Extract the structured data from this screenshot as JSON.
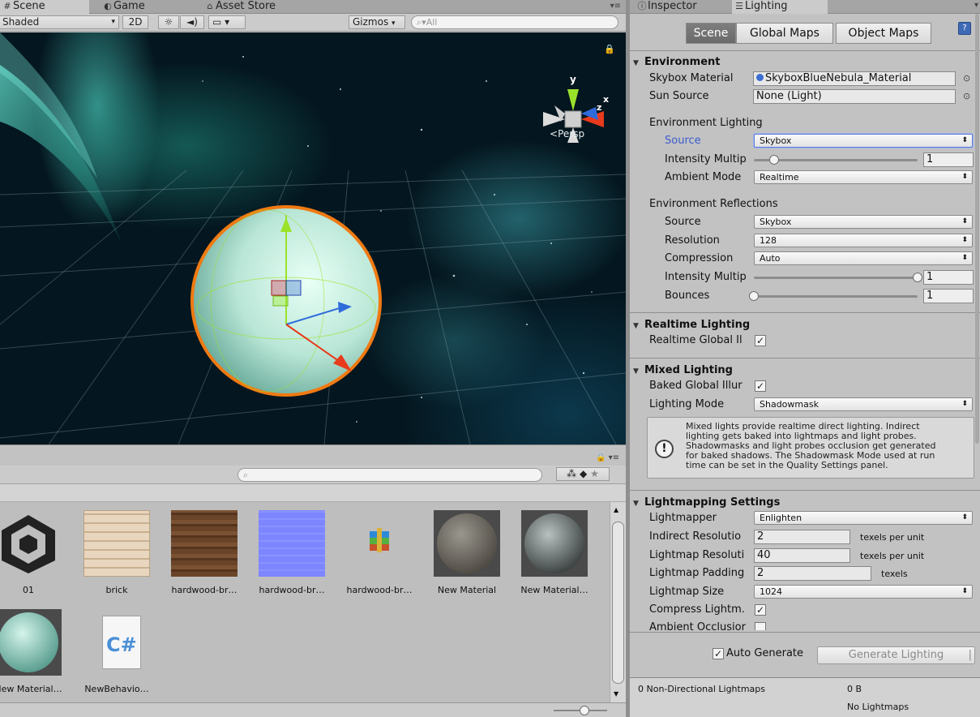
{
  "scene_tabs": {
    "scene": "Scene",
    "game": "Game",
    "asset_store": "Asset Store"
  },
  "scene_toolbar": {
    "draw_mode": "Shaded",
    "mode_2d": "2D",
    "gizmos": "Gizmos",
    "search_placeholder": "All"
  },
  "scene_view": {
    "gizmo_axes": {
      "y": "y",
      "x": "x",
      "z": "z"
    },
    "projection": "Persp"
  },
  "project": {
    "assets": [
      {
        "label": "01",
        "kind": "unity-logo"
      },
      {
        "label": "brick",
        "kind": "brick-texture"
      },
      {
        "label": "hardwood-br…",
        "kind": "wood-texture"
      },
      {
        "label": "hardwood-br…",
        "kind": "normal-map"
      },
      {
        "label": "hardwood-br…",
        "kind": "archive-icon"
      },
      {
        "label": "New Material",
        "kind": "sphere-striped"
      },
      {
        "label": "New Material…",
        "kind": "sphere-gray"
      },
      {
        "label": "New Material…",
        "kind": "sphere-teal"
      },
      {
        "label": "NewBehavio…",
        "kind": "csharp-script"
      }
    ]
  },
  "right_tabs": {
    "inspector": "Inspector",
    "lighting": "Lighting"
  },
  "lighting": {
    "tabs": {
      "scene": "Scene",
      "global_maps": "Global Maps",
      "object_maps": "Object Maps"
    },
    "environment": {
      "header": "Environment",
      "skybox_label": "Skybox Material",
      "skybox_value": "SkyboxBlueNebula_Material",
      "sun_label": "Sun Source",
      "sun_value": "None (Light)",
      "env_lighting": "Environment Lighting",
      "source_label": "Source",
      "source_value": "Skybox",
      "intensity_label": "Intensity Multip",
      "intensity_value": "1",
      "intensity_fraction": 0.125,
      "ambient_label": "Ambient Mode",
      "ambient_value": "Realtime",
      "env_reflections": "Environment Reflections",
      "refl_source_label": "Source",
      "refl_source_value": "Skybox",
      "resolution_label": "Resolution",
      "resolution_value": "128",
      "compression_label": "Compression",
      "compression_value": "Auto",
      "refl_intensity_label": "Intensity Multip",
      "refl_intensity_value": "1",
      "refl_intensity_fraction": 1.0,
      "bounces_label": "Bounces",
      "bounces_value": "1",
      "bounces_fraction": 0.0
    },
    "realtime": {
      "header": "Realtime Lighting",
      "gi_label": "Realtime Global Il",
      "gi_checked": "✓"
    },
    "mixed": {
      "header": "Mixed Lighting",
      "baked_label": "Baked Global Illur",
      "baked_checked": "✓",
      "mode_label": "Lighting Mode",
      "mode_value": "Shadowmask",
      "help_line1": "Mixed lights provide realtime direct lighting. Indirect",
      "help_line2": "lighting gets baked into lightmaps and light probes.",
      "help_line3": "Shadowmasks and light probes occlusion get generated",
      "help_line4": "for baked shadows. The Shadowmask Mode used at run",
      "help_line5": "time can be set in the Quality Settings panel."
    },
    "lightmapping": {
      "header": "Lightmapping Settings",
      "lightmapper_label": "Lightmapper",
      "lightmapper_value": "Enlighten",
      "indirect_label": "Indirect Resolutio",
      "indirect_value": "2",
      "indirect_unit": "texels per unit",
      "lm_res_label": "Lightmap Resoluti",
      "lm_res_value": "40",
      "lm_res_unit": "texels per unit",
      "padding_label": "Lightmap Padding",
      "padding_value": "2",
      "padding_unit": "texels",
      "size_label": "Lightmap Size",
      "size_value": "1024",
      "compress_label": "Compress Lightm.",
      "compress_checked": "✓",
      "ao_label": "Ambient Occlusior",
      "ao_checked": ""
    },
    "footer": {
      "auto_generate": "Auto Generate",
      "auto_checked": "✓",
      "generate_button": "Generate Lighting",
      "lightmaps_count": "0 Non-Directional Lightmaps",
      "size": "0 B",
      "no_lightmaps": "No Lightmaps"
    }
  },
  "colors": {
    "focus_label": "#3b5ccc",
    "selection_orange": "#f07a12",
    "axis_y": "#9be22b",
    "axis_x": "#e83a1c",
    "axis_z": "#2f6bdb"
  }
}
